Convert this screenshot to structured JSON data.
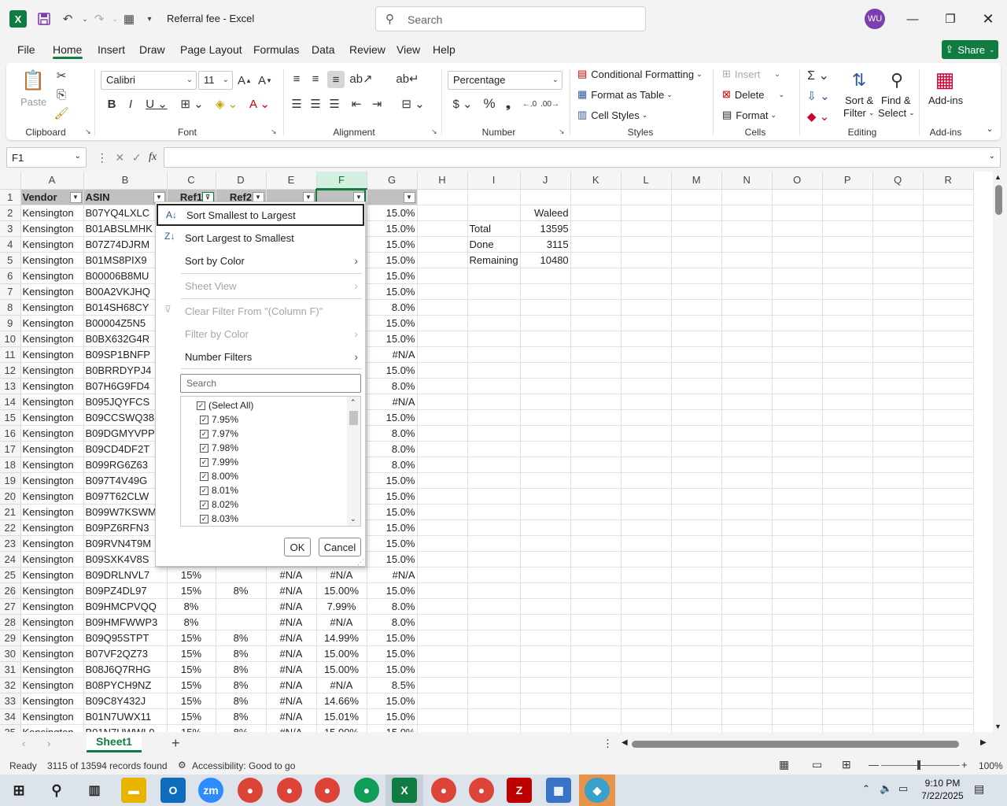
{
  "window": {
    "doc_title": "Referral fee  -  Excel",
    "search_placeholder": "Search",
    "avatar_initials": "WU"
  },
  "menu": {
    "tabs": [
      "File",
      "Home",
      "Insert",
      "Draw",
      "Page Layout",
      "Formulas",
      "Data",
      "Review",
      "View",
      "Help"
    ],
    "active": "Home",
    "share_label": "Share"
  },
  "ribbon": {
    "clipboard": {
      "label": "Clipboard",
      "paste": "Paste"
    },
    "font": {
      "label": "Font",
      "name": "Calibri",
      "size": "11"
    },
    "alignment": {
      "label": "Alignment"
    },
    "number": {
      "label": "Number",
      "format": "Percentage"
    },
    "styles": {
      "label": "Styles",
      "conditional": "Conditional Formatting",
      "format_table": "Format as Table",
      "cell_styles": "Cell Styles"
    },
    "cells": {
      "label": "Cells",
      "insert": "Insert",
      "delete": "Delete",
      "format": "Format"
    },
    "editing": {
      "label": "Editing",
      "sort_filter": "Sort &",
      "sort_filter2": "Filter",
      "find_select": "Find &",
      "find_select2": "Select"
    },
    "addins": {
      "label": "Add-ins",
      "button": "Add-ins"
    }
  },
  "formula_bar": {
    "name_box": "F1",
    "fx": "fx",
    "content": ""
  },
  "columns": [
    "A",
    "B",
    "C",
    "D",
    "E",
    "F",
    "G",
    "H",
    "I",
    "J",
    "K",
    "L",
    "M",
    "N",
    "O",
    "P",
    "Q",
    "R"
  ],
  "headers": {
    "A": "Vendor",
    "B": "ASIN",
    "C": "Ref1",
    "D": "Ref2"
  },
  "rows": [
    {
      "n": "2",
      "A": "Kensington",
      "B": "B07YQ4LXLC",
      "G": "15.0%",
      "J": "Waleed"
    },
    {
      "n": "3",
      "A": "Kensington",
      "B": "B01ABSLMHK",
      "G": "15.0%",
      "I": "Total",
      "J": "13595"
    },
    {
      "n": "4",
      "A": "Kensington",
      "B": "B07Z74DJRM",
      "G": "15.0%",
      "I": "Done",
      "J": "3115"
    },
    {
      "n": "5",
      "A": "Kensington",
      "B": "B01MS8PIX9",
      "G": "15.0%",
      "I": "Remaining",
      "J": "10480"
    },
    {
      "n": "6",
      "A": "Kensington",
      "B": "B00006B8MU",
      "G": "15.0%"
    },
    {
      "n": "7",
      "A": "Kensington",
      "B": "B00A2VKJHQ",
      "G": "15.0%"
    },
    {
      "n": "8",
      "A": "Kensington",
      "B": "B014SH68CY",
      "G": "8.0%"
    },
    {
      "n": "9",
      "A": "Kensington",
      "B": "B00004Z5N5",
      "G": "15.0%"
    },
    {
      "n": "10",
      "A": "Kensington",
      "B": "B0BX632G4R",
      "G": "15.0%"
    },
    {
      "n": "11",
      "A": "Kensington",
      "B": "B09SP1BNFP",
      "G": "#N/A"
    },
    {
      "n": "12",
      "A": "Kensington",
      "B": "B0BRRDYPJ4",
      "G": "15.0%"
    },
    {
      "n": "13",
      "A": "Kensington",
      "B": "B07H6G9FD4",
      "G": "8.0%"
    },
    {
      "n": "14",
      "A": "Kensington",
      "B": "B095JQYFCS",
      "G": "#N/A"
    },
    {
      "n": "15",
      "A": "Kensington",
      "B": "B09CCSWQ38",
      "G": "15.0%"
    },
    {
      "n": "16",
      "A": "Kensington",
      "B": "B09DGMYVPP",
      "G": "8.0%"
    },
    {
      "n": "17",
      "A": "Kensington",
      "B": "B09CD4DF2T",
      "G": "8.0%"
    },
    {
      "n": "18",
      "A": "Kensington",
      "B": "B099RG6Z63",
      "G": "8.0%"
    },
    {
      "n": "19",
      "A": "Kensington",
      "B": "B097T4V49G",
      "G": "15.0%"
    },
    {
      "n": "20",
      "A": "Kensington",
      "B": "B097T62CLW",
      "G": "15.0%"
    },
    {
      "n": "21",
      "A": "Kensington",
      "B": "B099W7KSWM",
      "G": "15.0%"
    },
    {
      "n": "22",
      "A": "Kensington",
      "B": "B09PZ6RFN3",
      "G": "15.0%"
    },
    {
      "n": "23",
      "A": "Kensington",
      "B": "B09RVN4T9M",
      "G": "15.0%"
    },
    {
      "n": "24",
      "A": "Kensington",
      "B": "B09SXK4V8S",
      "G": "15.0%"
    },
    {
      "n": "25",
      "A": "Kensington",
      "B": "B09DRLNVL7",
      "C": "15%",
      "D": "",
      "E": "#N/A",
      "F": "#N/A",
      "G": "#N/A"
    },
    {
      "n": "26",
      "A": "Kensington",
      "B": "B09PZ4DL97",
      "C": "15%",
      "D": "8%",
      "E": "#N/A",
      "F": "15.00%",
      "G": "15.0%"
    },
    {
      "n": "27",
      "A": "Kensington",
      "B": "B09HMCPVQQ",
      "C": "8%",
      "D": "",
      "E": "#N/A",
      "F": "7.99%",
      "G": "8.0%"
    },
    {
      "n": "28",
      "A": "Kensington",
      "B": "B09HMFWWP3",
      "C": "8%",
      "D": "",
      "E": "#N/A",
      "F": "#N/A",
      "G": "8.0%"
    },
    {
      "n": "29",
      "A": "Kensington",
      "B": "B09Q95STPT",
      "C": "15%",
      "D": "8%",
      "E": "#N/A",
      "F": "14.99%",
      "G": "15.0%"
    },
    {
      "n": "30",
      "A": "Kensington",
      "B": "B07VF2QZ73",
      "C": "15%",
      "D": "8%",
      "E": "#N/A",
      "F": "15.00%",
      "G": "15.0%"
    },
    {
      "n": "31",
      "A": "Kensington",
      "B": "B08J6Q7RHG",
      "C": "15%",
      "D": "8%",
      "E": "#N/A",
      "F": "15.00%",
      "G": "15.0%"
    },
    {
      "n": "32",
      "A": "Kensington",
      "B": "B08PYCH9NZ",
      "C": "15%",
      "D": "8%",
      "E": "#N/A",
      "F": "#N/A",
      "G": "8.5%"
    },
    {
      "n": "33",
      "A": "Kensington",
      "B": "B09C8Y432J",
      "C": "15%",
      "D": "8%",
      "E": "#N/A",
      "F": "14.66%",
      "G": "15.0%"
    },
    {
      "n": "34",
      "A": "Kensington",
      "B": "B01N7UWX11",
      "C": "15%",
      "D": "8%",
      "E": "#N/A",
      "F": "15.01%",
      "G": "15.0%"
    },
    {
      "n": "35",
      "A": "Kensington",
      "B": "B01N7UWWL9",
      "C": "15%",
      "D": "8%",
      "E": "#N/A",
      "F": "15.00%",
      "G": "15.0%"
    }
  ],
  "filter_menu": {
    "sort_asc": "Sort Smallest to Largest",
    "sort_desc": "Sort Largest to Smallest",
    "sort_color": "Sort by Color",
    "sheet_view": "Sheet View",
    "clear_filter": "Clear Filter From \"(Column F)\"",
    "filter_color": "Filter by Color",
    "number_filters": "Number Filters",
    "search_placeholder": "Search",
    "values": [
      "(Select All)",
      "7.95%",
      "7.97%",
      "7.98%",
      "7.99%",
      "8.00%",
      "8.01%",
      "8.02%",
      "8.03%"
    ],
    "ok": "OK",
    "cancel": "Cancel"
  },
  "sheet": {
    "tab": "Sheet1",
    "add": "+"
  },
  "status": {
    "ready": "Ready",
    "records": "3115 of 13594 records found",
    "accessibility": "Accessibility: Good to go",
    "zoom": "100%"
  },
  "taskbar": {
    "time": "9:10 PM",
    "date": "7/22/2025"
  }
}
